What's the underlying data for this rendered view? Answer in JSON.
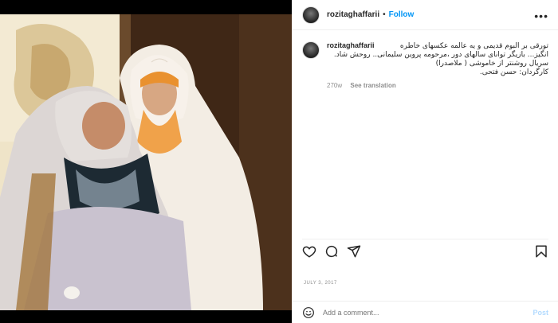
{
  "post": {
    "username": "rozitaghaffarii",
    "follow_label": "Follow",
    "more_label": "•••",
    "caption_username": "rozitaghaffarii",
    "caption_lines": [
      "تورقی بر البوم قدیمی و یه عالمه عکسهای خاطره",
      "انگیز... بازیگر توانای سالهای دور ،مرحومه پروین سلیمانی.. روحش شاد.",
      "سریال روشنتر از خاموشی ( ملاصدرا)",
      "کارگردان: حسن فتحی."
    ],
    "caption_time": "270w",
    "see_translation": "See translation",
    "date": "JULY 3, 2017",
    "comment_placeholder": "Add a comment...",
    "post_label": "Post"
  },
  "icons": [
    "heart-icon",
    "comment-icon",
    "share-icon",
    "bookmark-icon",
    "emoji-icon"
  ],
  "colors": {
    "follow": "#0095f6",
    "muted": "#8e8e8e",
    "post_disabled": "#b3dbff"
  }
}
